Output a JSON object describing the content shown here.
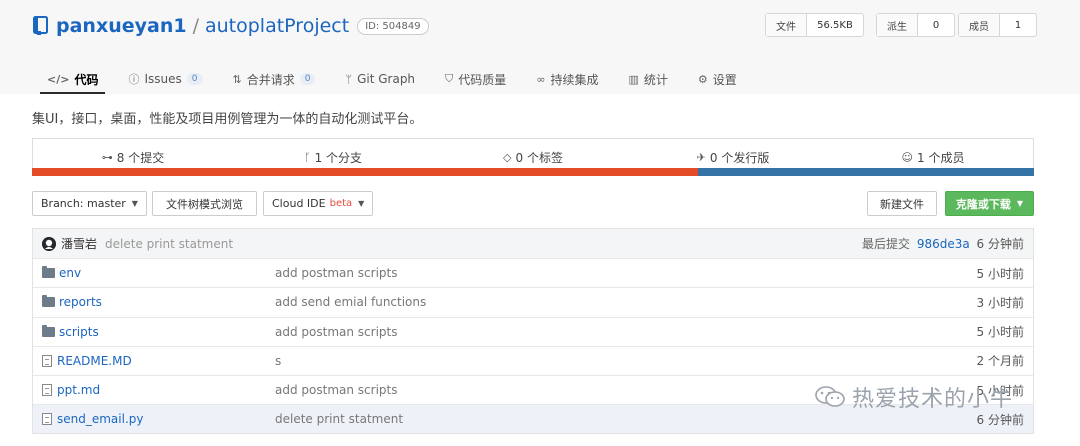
{
  "repo": {
    "owner": "panxueyan1",
    "separator": "/",
    "name": "autoplatProject",
    "id": "ID: 504849"
  },
  "stats": [
    {
      "label": "文件",
      "value": "56.5KB"
    },
    {
      "label": "派生",
      "value": "0"
    },
    {
      "label": "成员",
      "value": "1"
    }
  ],
  "tabs": [
    {
      "icon": "code-icon",
      "label": "代码",
      "count": ""
    },
    {
      "icon": "issues-icon",
      "label": "Issues",
      "count": "0"
    },
    {
      "icon": "merge-icon",
      "label": "合并请求",
      "count": "0"
    },
    {
      "icon": "git-graph-icon",
      "label": "Git Graph",
      "count": ""
    },
    {
      "icon": "shield-icon",
      "label": "代码质量",
      "count": ""
    },
    {
      "icon": "infinity-icon",
      "label": "持续集成",
      "count": ""
    },
    {
      "icon": "bar-chart-icon",
      "label": "统计",
      "count": ""
    },
    {
      "icon": "gear-icon",
      "label": "设置",
      "count": ""
    }
  ],
  "description": "集UI，接口，桌面，性能及项目用例管理为一体的自动化测试平台。",
  "summary": [
    {
      "icon": "commit-icon",
      "label": "8 个提交"
    },
    {
      "icon": "branch-icon",
      "label": "1 个分支"
    },
    {
      "icon": "tag-icon",
      "label": "0 个标签"
    },
    {
      "icon": "release-icon",
      "label": "0 个发行版"
    },
    {
      "icon": "user-icon",
      "label": "1 个成员"
    }
  ],
  "language_bar": {
    "segments": [
      {
        "color": "#e34c26",
        "fraction": 0.665
      },
      {
        "color": "#3572a5",
        "fraction": 0.335
      }
    ]
  },
  "toolbar": {
    "branch": "Branch: master",
    "tree_view": "文件树模式浏览",
    "cloud_ide": "Cloud IDE",
    "beta": "beta",
    "new_file": "新建文件",
    "clone": "克隆或下载"
  },
  "last_commit": {
    "author": "潘雪岩",
    "message": "delete print statment",
    "prefix": "最后提交",
    "hash": "986de3a",
    "time": "6 分钟前"
  },
  "files": [
    {
      "type": "folder",
      "name": "env",
      "message": "add postman scripts",
      "time": "5 小时前"
    },
    {
      "type": "folder",
      "name": "reports",
      "message": "add send emial functions",
      "time": "3 小时前"
    },
    {
      "type": "folder",
      "name": "scripts",
      "message": "add postman scripts",
      "time": "5 小时前"
    },
    {
      "type": "file",
      "name": "README.MD",
      "message": "s",
      "time": "2 个月前"
    },
    {
      "type": "file",
      "name": "ppt.md",
      "message": "add postman scripts",
      "time": "5 小时前"
    },
    {
      "type": "file",
      "name": "send_email.py",
      "message": "delete print statment",
      "time": "6 分钟前"
    }
  ],
  "watermark": {
    "text": "热爱技术的小牛",
    "icon": "wechat-icon"
  }
}
